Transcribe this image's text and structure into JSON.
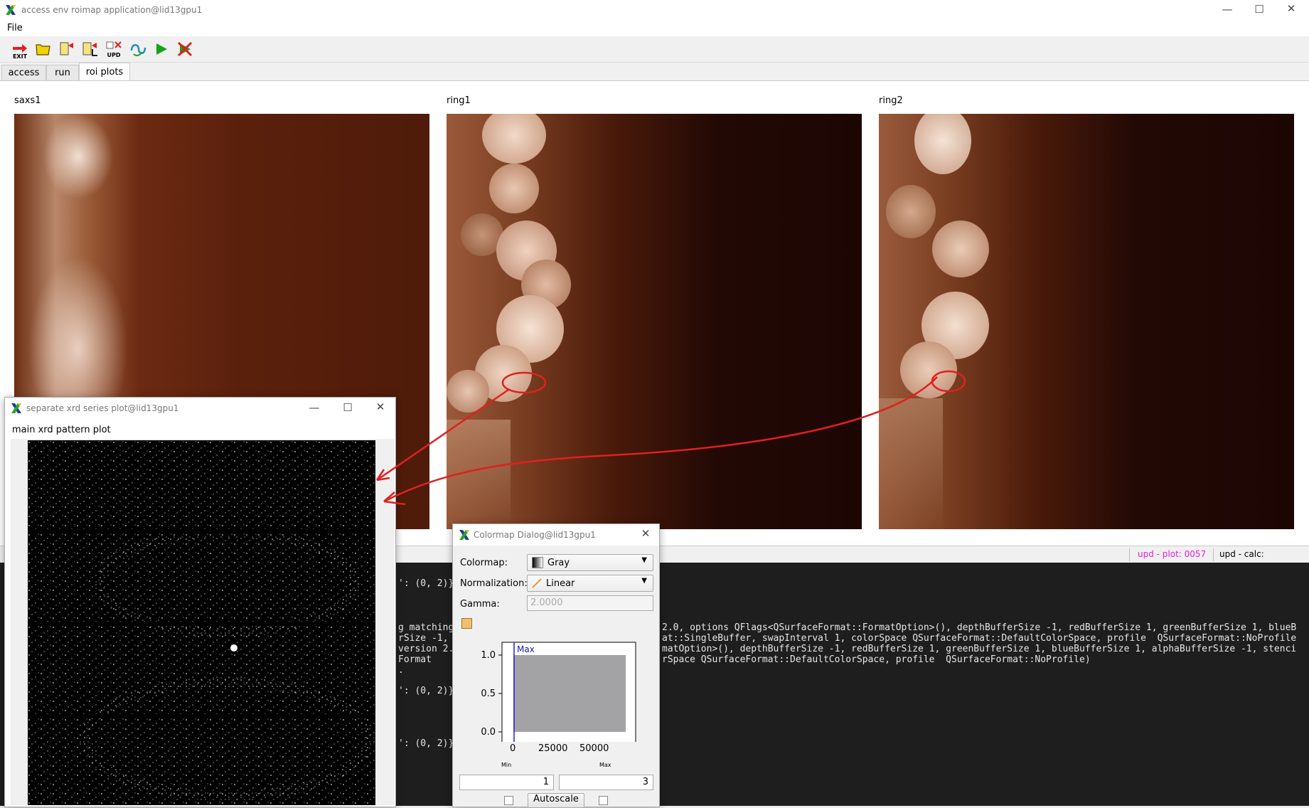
{
  "main_window": {
    "title": "access env roimap application@lid13gpu1",
    "menu": [
      "File"
    ],
    "toolbar": {
      "exit_label": "EXIT",
      "upd_label": "UPD",
      "icons": [
        "exit-icon",
        "open-folder-icon",
        "load-icon",
        "load-l-icon",
        "update-icon",
        "cycle-icon",
        "play-icon",
        "stop-icon"
      ]
    },
    "tabs": [
      {
        "label": "access",
        "active": false
      },
      {
        "label": "run",
        "active": false
      },
      {
        "label": "roi plots",
        "active": true
      }
    ],
    "plots": [
      {
        "label": "saxs1"
      },
      {
        "label": "ring1"
      },
      {
        "label": "ring2"
      }
    ],
    "status": {
      "plot": "upd - plot: 0057",
      "calc": "upd - calc:"
    },
    "console_lines": [
      "': (0, 2)}",
      "g matching",
      "rSize -1,",
      "version 2.",
      "Format",
      ".",
      "': (0, 2)}",
      "': (0, 2)}"
    ],
    "console_right_lines": [
      "2.0, options QFlags<QSurfaceFormat::FormatOption>(), depthBufferSize -1, redBufferSize 1, greenBufferSize 1, blueB",
      "at::SingleBuffer, swapInterval 1, colorSpace QSurfaceFormat::DefaultColorSpace, profile  QSurfaceFormat::NoProfile",
      "matOption>(), depthBufferSize -1, redBufferSize 1, greenBufferSize 1, blueBufferSize 1, alphaBufferSize -1, stenci",
      "rSpace QSurfaceFormat::DefaultColorSpace, profile  QSurfaceFormat::NoProfile)"
    ]
  },
  "xrd_window": {
    "title": "separate xrd series plot@lid13gpu1",
    "plot_label": "main xrd pattern plot"
  },
  "colormap_dialog": {
    "title": "Colormap Dialog@lid13gpu1",
    "colormap_label": "Colormap:",
    "colormap_value": "Gray",
    "normalization_label": "Normalization:",
    "normalization_value": "Linear",
    "gamma_label": "Gamma:",
    "gamma_value": "2.0000",
    "histogram": {
      "max_label": "Max",
      "y_ticks": [
        "1.0",
        "0.5",
        "0.0"
      ],
      "x_ticks": [
        "0",
        "25000",
        "50000"
      ]
    },
    "min_label": "Min",
    "max_label": "Max",
    "min_value": "1",
    "max_value": "3",
    "autoscale_label": "Autoscale"
  },
  "colors": {
    "accent_magenta": "#e020e0",
    "annotation_red": "#e02020",
    "console_bg": "#1e1e1e",
    "histogram_fill": "#a3a3a6",
    "max_marker": "#2222cc"
  }
}
